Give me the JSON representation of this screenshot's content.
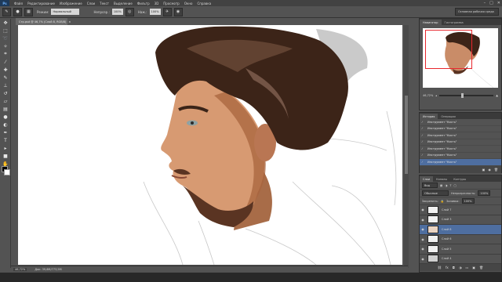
{
  "app": {
    "logo": "Ps"
  },
  "menu": [
    "Файл",
    "Редактирование",
    "Изображение",
    "Слои",
    "Текст",
    "Выделение",
    "Фильтр",
    "3D",
    "Просмотр",
    "Окно",
    "Справка"
  ],
  "window_controls": [
    "–",
    "□",
    "✕"
  ],
  "options": {
    "mode_label": "Режим:",
    "mode_value": "Нормальный",
    "opacity_label": "Непрозр.:",
    "opacity_value": "100%",
    "flow_label": "Наж.:",
    "flow_value": "100%",
    "workspace": "Основная рабочая среда"
  },
  "document_tab": {
    "title": "Cтр.psd @ 46,7% (Слой 8, RGB/8)",
    "close": "×"
  },
  "status": {
    "zoom": "46,72%",
    "doc_size": "Док: 39,6M/773,5M"
  },
  "navigator": {
    "tabs": [
      "Навигатор",
      "Гистограмма"
    ],
    "zoom": "46,72%"
  },
  "history": {
    "tabs": [
      "История",
      "Операции"
    ],
    "items": [
      "Инструмент \"Кисть\"",
      "Инструмент \"Кисть\"",
      "Инструмент \"Кисть\"",
      "Инструмент \"Кисть\"",
      "Инструмент \"Кисть\"",
      "Инструмент \"Кисть\"",
      "Инструмент \"Кисть\"",
      "Инструмент \"Кисть\""
    ]
  },
  "layers": {
    "tabs": [
      "Слои",
      "Каналы",
      "Контуры"
    ],
    "filter": "Вид",
    "blend": "Обычные",
    "opacity_label": "Непрозрачность:",
    "opacity_value": "100%",
    "lock_label": "Закрепить:",
    "fill_label": "Заливка:",
    "fill_value": "100%",
    "items": [
      "Слой 7",
      "Слой 3",
      "Слой 8",
      "Слой 6",
      "Слой 5",
      "Слой 4"
    ]
  },
  "colors": {
    "accent": "#4e6ea0",
    "nav_rect": "#e8262d"
  }
}
